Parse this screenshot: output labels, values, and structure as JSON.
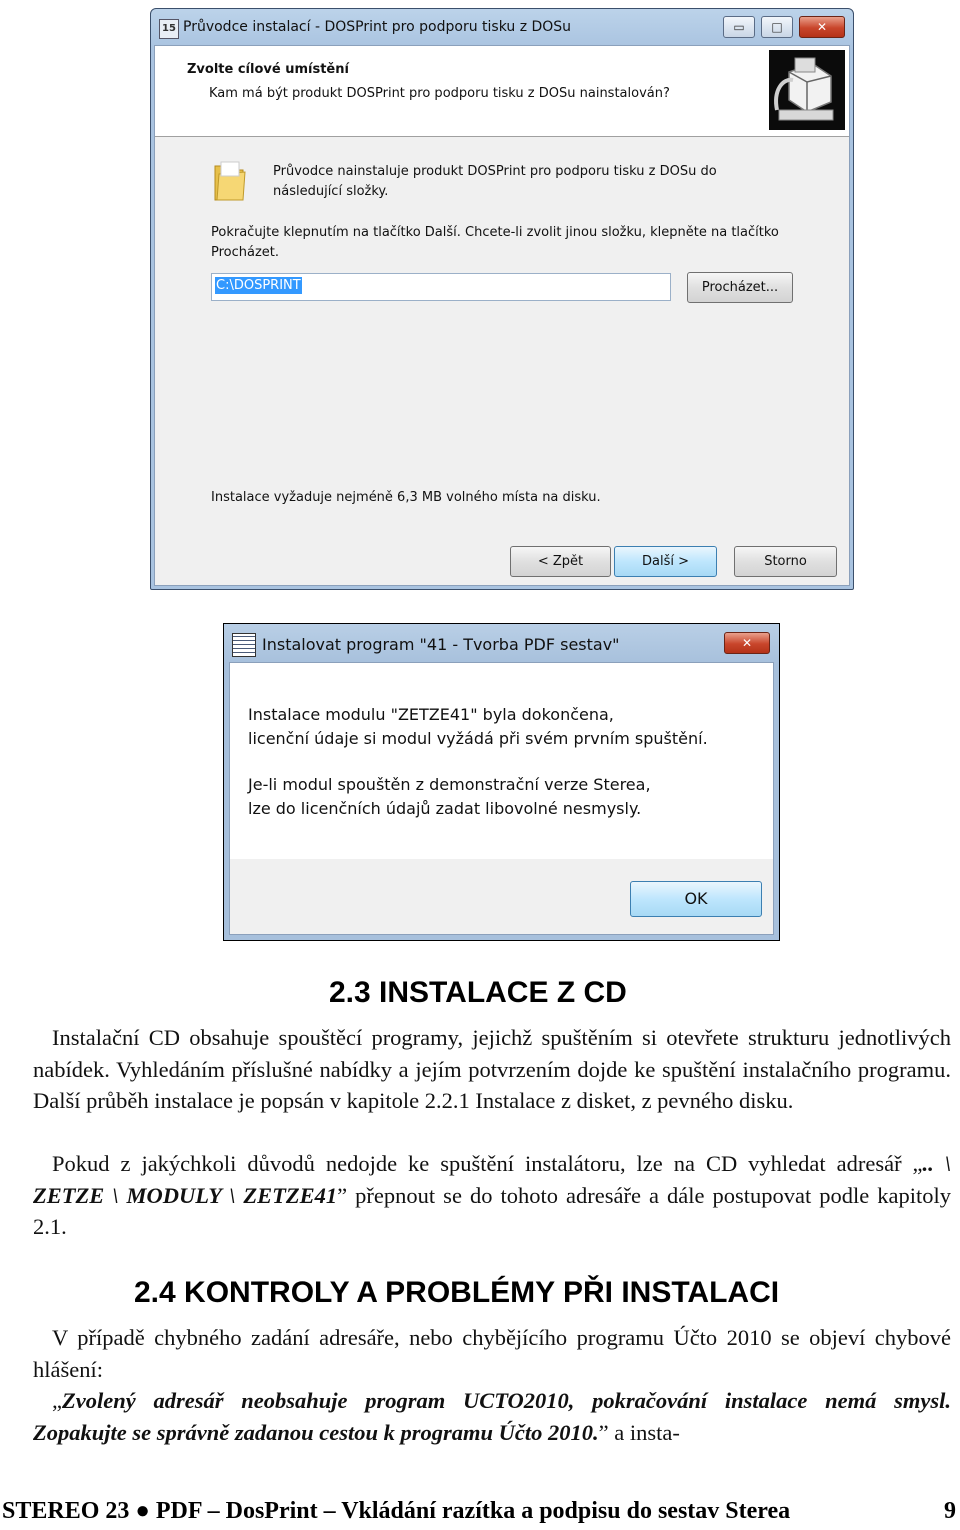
{
  "wizard": {
    "title": "Průvodce instalací - DOSPrint pro podporu tisku z DOSu",
    "header_title": "Zvolte cílové umístění",
    "header_subtitle": "Kam má být produkt DOSPrint pro podporu tisku z DOSu nainstalován?",
    "info_line1": "Průvodce nainstaluje produkt DOSPrint pro podporu tisku z DOSu do",
    "info_line2": "následující složky.",
    "instr_line1": "Pokračujte klepnutím na tlačítko Další. Chcete-li zvolit jinou složku, klepněte na tlačítko",
    "instr_line2": "Procházet.",
    "path_value": "C:\\DOSPRINT",
    "browse_label": "Procházet...",
    "space_note": "Instalace vyžaduje nejméně 6,3 MB volného místa na disku.",
    "back_label": "< Zpět",
    "next_label": "Další >",
    "cancel_label": "Storno",
    "minimize_glyph": "▭",
    "maximize_glyph": "□",
    "close_glyph": "✕"
  },
  "msgbox": {
    "title": "Instalovat program \"41 - Tvorba PDF sestav\"",
    "line1": "Instalace modulu \"ZETZE41\" byla dokončena,",
    "line2": "licenční údaje si modul vyžádá při svém prvním spuštění.",
    "line3": "Je-li modul spouštěn z demonstrační verze Sterea,",
    "line4": "lze do licenčních údajů zadat libovolné nesmysly.",
    "ok_label": "OK",
    "close_glyph": "✕"
  },
  "section_2_3": {
    "heading": "2.3 INSTALACE Z CD",
    "p1": "Instalační CD obsahuje spouštěcí programy, jejichž spuštěním si otevřete strukturu jednotlivých nabídek. Vyhledáním příslušné nabídky a jejím potvrzením dojde ke spuštění instalačního programu. Další průběh instalace je popsán v kapitole 2.2.1 Instalace z disket, z pevného disku.",
    "p2_before": "Pokud z jakýchkoli důvodů nedojde ke spuštění instalátoru, lze na CD vyhledat adresář „",
    "p2_path": ".. \\ ZETZE \\ MODULY \\ ZETZE41",
    "p2_after": "” přepnout se do tohoto adresáře a dále postupovat podle kapitoly 2.1."
  },
  "section_2_4": {
    "heading": "2.4 KONTROLY A PROBLÉMY PŘI INSTALACI",
    "p1": "V případě chybného zadání adresáře, nebo chybějícího programu Účto 2010 se objeví chybové hlášení:",
    "p2_open_quote": "„",
    "p2_message": "Zvolený adresář neobsahuje program UCTO2010, pokračování instalace nemá smysl. Zopakujte se správně zadanou cestou k programu Účto 2010.",
    "p2_after": "” a insta-"
  },
  "footer": {
    "text": "STEREO 23 ● PDF – DosPrint – Vkládání razítka a podpisu do sestav Sterea",
    "page_number": "9"
  }
}
